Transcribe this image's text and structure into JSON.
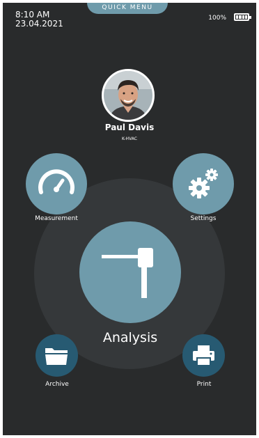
{
  "status": {
    "time": "8:10 AM",
    "date": "23.04.2021",
    "battery_percent": "100%",
    "battery_level": 1.0
  },
  "quick_menu": {
    "label": "QUICK MENU"
  },
  "user": {
    "name": "Paul Davis",
    "org": "K-HVAC"
  },
  "menu": {
    "measurement": {
      "label": "Measurement",
      "icon": "gauge-icon"
    },
    "settings": {
      "label": "Settings",
      "icon": "gears-icon"
    },
    "analysis": {
      "label": "Analysis",
      "icon": "probe-icon"
    },
    "archive": {
      "label": "Archive",
      "icon": "folder-icon"
    },
    "print": {
      "label": "Print",
      "icon": "printer-icon"
    }
  },
  "colors": {
    "background": "#292b2c",
    "ring": "#35383a",
    "accent_light": "#6f9bab",
    "accent_dark": "#275a72"
  }
}
